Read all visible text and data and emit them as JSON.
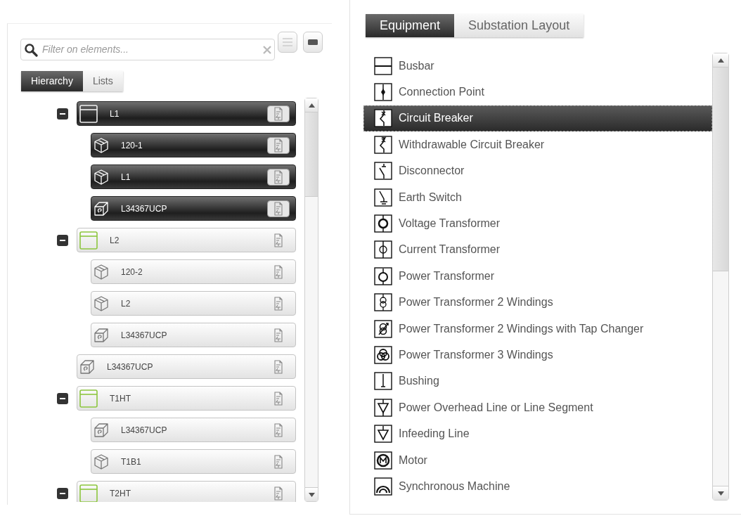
{
  "filter": {
    "placeholder": "Filter on elements..."
  },
  "left_tabs": [
    {
      "label": "Hierarchy",
      "selected": true
    },
    {
      "label": "Lists",
      "selected": false
    }
  ],
  "tree": {
    "items": [
      {
        "label": "L1",
        "kind": "bay",
        "selected": true,
        "expanded": true,
        "children": [
          {
            "label": "120-1",
            "kind": "device",
            "selected": true
          },
          {
            "label": "L1",
            "kind": "device",
            "selected": true
          },
          {
            "label": "L34367UCP",
            "kind": "ied",
            "selected": true
          }
        ]
      },
      {
        "label": "L2",
        "kind": "bay",
        "selected": false,
        "expanded": true,
        "children": [
          {
            "label": "120-2",
            "kind": "device",
            "selected": false
          },
          {
            "label": "L2",
            "kind": "device",
            "selected": false
          },
          {
            "label": "L34367UCP",
            "kind": "ied",
            "selected": false
          }
        ]
      },
      {
        "label": "L34367UCP",
        "kind": "ied",
        "selected": false
      },
      {
        "label": "T1HT",
        "kind": "bay",
        "selected": false,
        "expanded": true,
        "children": [
          {
            "label": "L34367UCP",
            "kind": "ied",
            "selected": false
          },
          {
            "label": "T1B1",
            "kind": "device",
            "selected": false
          }
        ]
      },
      {
        "label": "T2HT",
        "kind": "bay",
        "selected": false,
        "expanded": true
      }
    ]
  },
  "right_tabs": [
    {
      "label": "Equipment",
      "selected": true
    },
    {
      "label": "Substation Layout",
      "selected": false
    }
  ],
  "equipment": [
    {
      "label": "Busbar",
      "kind": "busbar",
      "selected": false
    },
    {
      "label": "Connection Point",
      "kind": "connection-point",
      "selected": false
    },
    {
      "label": "Circuit Breaker",
      "kind": "circuit-breaker",
      "selected": true
    },
    {
      "label": "Withdrawable Circuit Breaker",
      "kind": "withdrawable-breaker",
      "selected": false
    },
    {
      "label": "Disconnector",
      "kind": "disconnector",
      "selected": false
    },
    {
      "label": "Earth Switch",
      "kind": "earth-switch",
      "selected": false
    },
    {
      "label": "Voltage Transformer",
      "kind": "voltage-transformer",
      "selected": false
    },
    {
      "label": "Current Transformer",
      "kind": "current-transformer",
      "selected": false
    },
    {
      "label": "Power Transformer",
      "kind": "power-transformer",
      "selected": false
    },
    {
      "label": "Power Transformer 2 Windings",
      "kind": "transformer-2w",
      "selected": false
    },
    {
      "label": "Power Transformer 2 Windings with Tap Changer",
      "kind": "transformer-2w-tap",
      "selected": false
    },
    {
      "label": "Power Transformer 3 Windings",
      "kind": "transformer-3w",
      "selected": false
    },
    {
      "label": "Bushing",
      "kind": "bushing",
      "selected": false
    },
    {
      "label": "Power Overhead Line or Line Segment",
      "kind": "overhead-line",
      "selected": false
    },
    {
      "label": "Infeeding Line",
      "kind": "infeeding-line",
      "selected": false
    },
    {
      "label": "Motor",
      "kind": "motor",
      "selected": false
    },
    {
      "label": "Synchronous Machine",
      "kind": "synchronous-machine",
      "selected": false
    }
  ]
}
